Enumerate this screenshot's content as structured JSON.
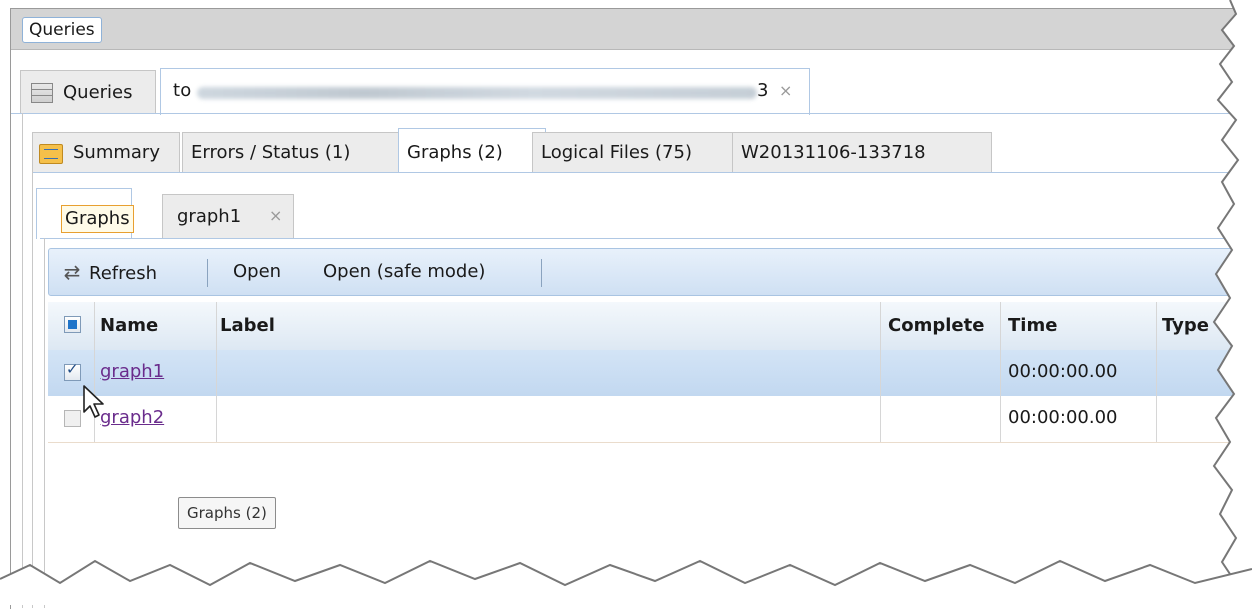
{
  "app": {
    "breadcrumb": "Queries"
  },
  "tabs_level1": {
    "queries_label": "Queries",
    "workunit_prefix": "to",
    "workunit_suffix": "3",
    "close_symbol": "×"
  },
  "tabs_level2": {
    "summary": "Summary",
    "errors": "Errors / Status (1)",
    "graphs": "Graphs (2)",
    "logical_files": "Logical Files (75)",
    "wuid": "W20131106-133718"
  },
  "tabs_level3": {
    "graphs": "Graphs",
    "graph1": "graph1",
    "close_symbol": "×"
  },
  "toolbar": {
    "refresh": "Refresh",
    "open": "Open",
    "open_safe": "Open (safe mode)"
  },
  "table": {
    "columns": {
      "name": "Name",
      "label": "Label",
      "completed": "Complete",
      "time": "Time",
      "type": "Type"
    },
    "rows": [
      {
        "name": "graph1",
        "label": "",
        "completed": "",
        "time": "00:00:00.00",
        "type": "",
        "checked": true
      },
      {
        "name": "graph2",
        "label": "",
        "completed": "",
        "time": "00:00:00.00",
        "type": "",
        "checked": false
      }
    ]
  },
  "tooltip": "Graphs (2)",
  "colors": {
    "selected_row": "#c7dcf2",
    "link": "#6a2c8c",
    "toolbar": "#dbe8f6"
  }
}
